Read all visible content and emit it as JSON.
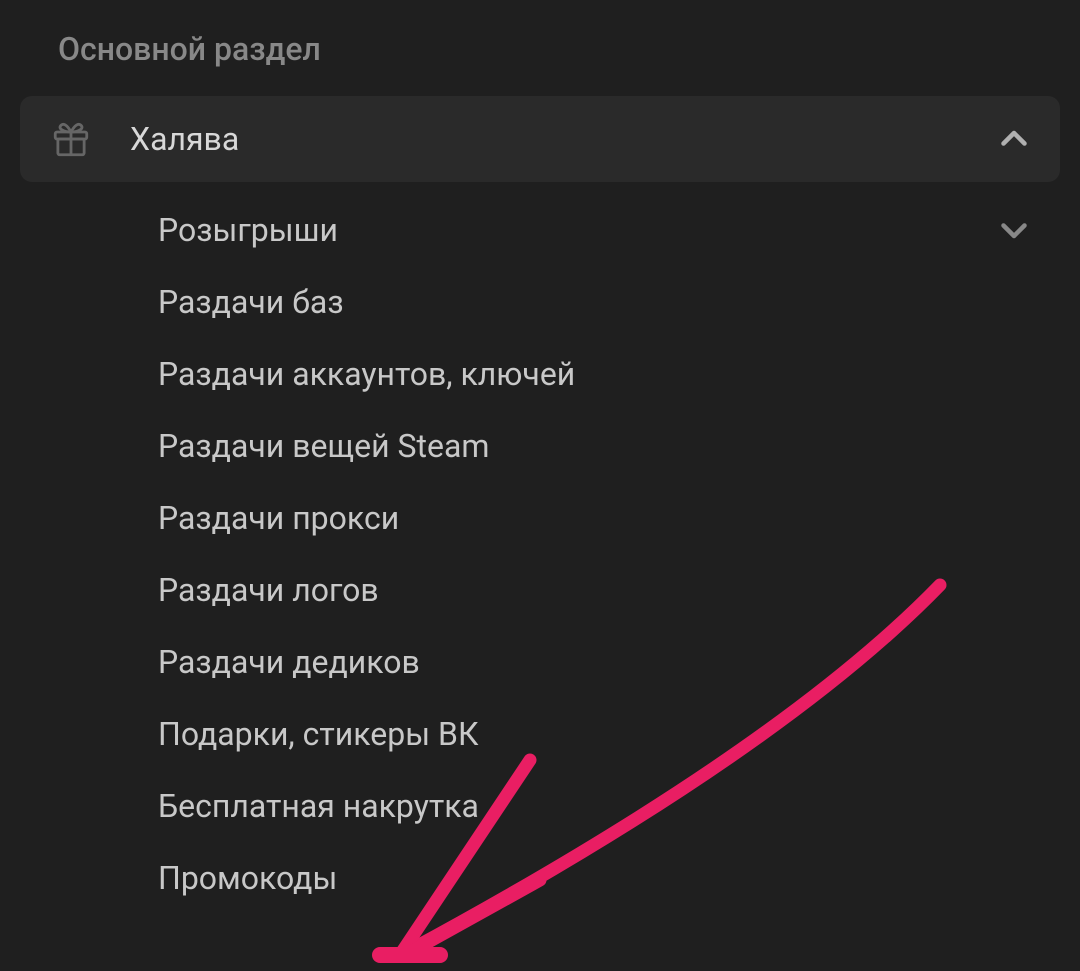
{
  "section": {
    "title": "Основной раздел"
  },
  "menu": {
    "header": {
      "label": "Халява"
    },
    "items": [
      {
        "label": "Розыгрыши",
        "has_chevron": true
      },
      {
        "label": "Раздачи баз",
        "has_chevron": false
      },
      {
        "label": "Раздачи аккаунтов, ключей",
        "has_chevron": false
      },
      {
        "label": "Раздачи вещей Steam",
        "has_chevron": false
      },
      {
        "label": "Раздачи прокси",
        "has_chevron": false
      },
      {
        "label": "Раздачи логов",
        "has_chevron": false
      },
      {
        "label": "Раздачи дедиков",
        "has_chevron": false
      },
      {
        "label": "Подарки, стикеры ВК",
        "has_chevron": false
      },
      {
        "label": "Бесплатная накрутка",
        "has_chevron": false
      },
      {
        "label": "Промокоды",
        "has_chevron": false
      }
    ]
  },
  "annotation": {
    "color": "#e91e63"
  }
}
